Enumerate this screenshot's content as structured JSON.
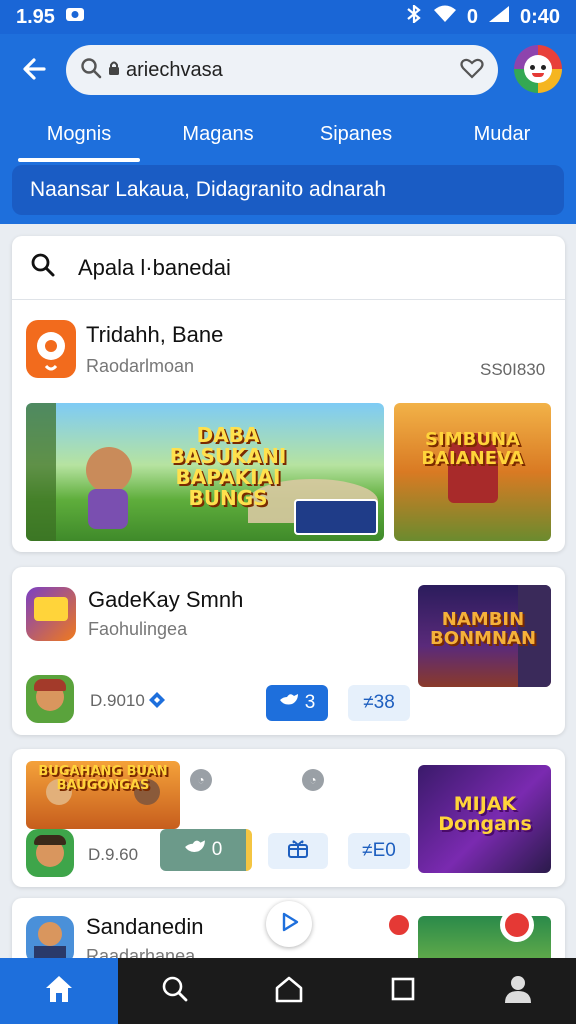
{
  "status": {
    "time": "1.95",
    "signal": "0",
    "battery": "0:40"
  },
  "search": {
    "value": "ariechvasa"
  },
  "tabs": [
    {
      "label": "Mognis"
    },
    {
      "label": "Magans"
    },
    {
      "label": "Sipanes"
    },
    {
      "label": "Mudar"
    }
  ],
  "banner": {
    "text": "Naansar Lakaua, Didagranito adnarah"
  },
  "card_search": {
    "query": "Apala l·banedai"
  },
  "apps": [
    {
      "title": "Tridahh, Bane",
      "subtitle": "Raodarlmoan",
      "meta": "SS0I830",
      "thumb_main": "DABA BASUKANI BAPAKIAI BUNGS",
      "thumb_side": "SIMBUNA BAIANEVA"
    },
    {
      "title": "GadeKay Smnh",
      "subtitle": "Faohulingea",
      "meta": "D.9010",
      "thumb": "NAMBIN BONMNAN",
      "chip_primary": "3",
      "chip_soft": "≠38"
    },
    {
      "meta": "D.9.60",
      "thumb": "MIJAK Dongans",
      "chip_primary": "0",
      "chip_soft": "≠E0",
      "thumb_left": "BUGAHANG BUAN BAUGONGAS"
    },
    {
      "title": "Sandanedin",
      "subtitle": "Raadarhanea"
    }
  ],
  "colors": {
    "primary": "#1e6fdc",
    "header": "#1a66d6",
    "background": "#e9edf2"
  },
  "icons": [
    "back-arrow-icon",
    "search-icon",
    "lock-icon",
    "heart-icon",
    "home-icon",
    "search-icon",
    "home-outline-icon",
    "square-icon",
    "person-icon"
  ]
}
